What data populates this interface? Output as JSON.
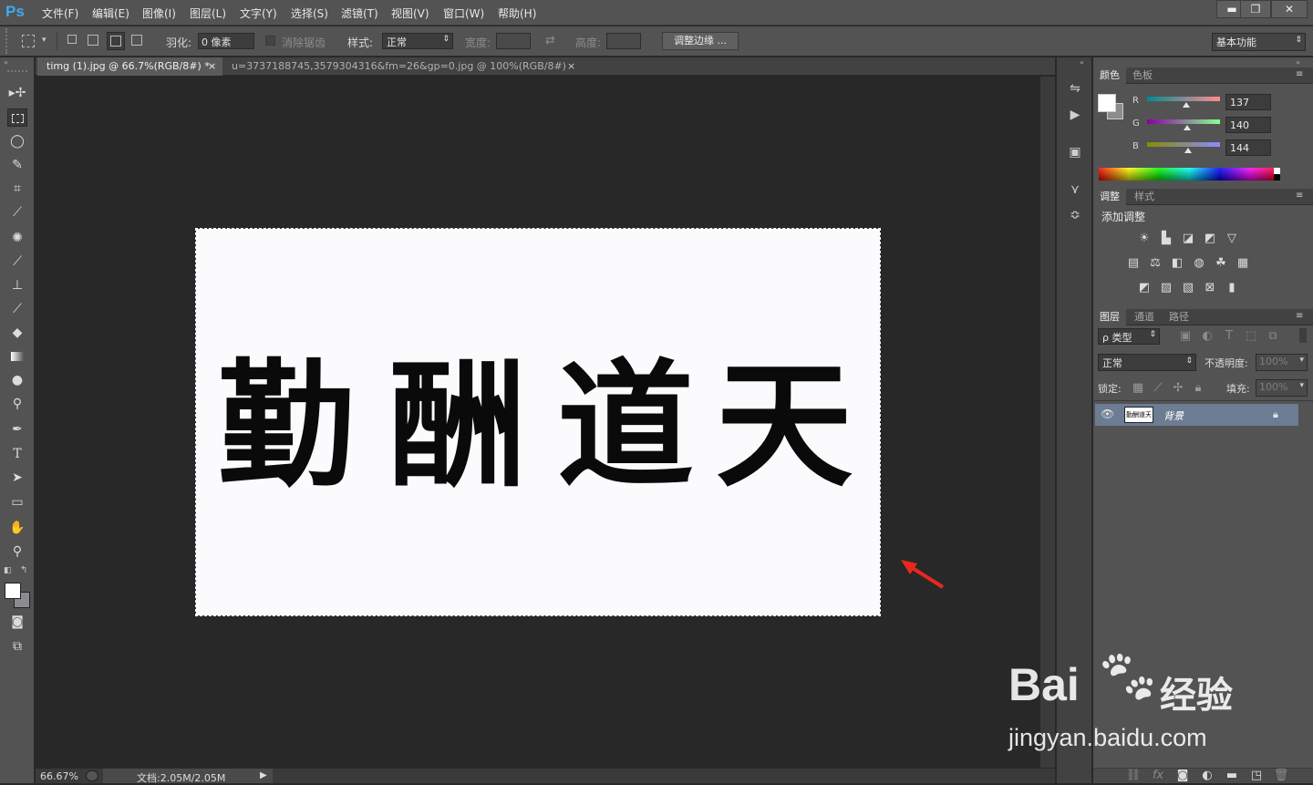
{
  "app": {
    "logo": "Ps",
    "menu": [
      "文件(F)",
      "编辑(E)",
      "图像(I)",
      "图层(L)",
      "文字(Y)",
      "选择(S)",
      "滤镜(T)",
      "视图(V)",
      "窗口(W)",
      "帮助(H)"
    ],
    "window_buttons": {
      "minimize": "▬",
      "restore": "❐",
      "close": "✕"
    }
  },
  "options": {
    "feather_label": "羽化:",
    "feather_value": "0 像素",
    "antialias_label": "消除锯齿",
    "style_label": "样式:",
    "style_value": "正常",
    "width_label": "宽度:",
    "height_label": "高度:",
    "refine_edge": "调整边缘 ...",
    "workspace": "基本功能"
  },
  "tabs": [
    {
      "label": "timg (1).jpg @ 66.7%(RGB/8#) *",
      "close": "×"
    },
    {
      "label": "u=3737188745,3579304316&fm=26&gp=0.jpg @ 100%(RGB/8#)",
      "close": "×"
    }
  ],
  "document": {
    "characters": [
      "勤",
      "酬",
      "道",
      "天"
    ]
  },
  "status": {
    "zoom": "66.67%",
    "doc_size": "文档:2.05M/2.05M"
  },
  "color_panel": {
    "tabs": [
      "颜色",
      "色板"
    ],
    "r_label": "R",
    "r_value": "137",
    "g_label": "G",
    "g_value": "140",
    "b_label": "B",
    "b_value": "144",
    "r": 137,
    "g": 140,
    "b": 144
  },
  "adjust_panel": {
    "tabs": [
      "调整",
      "样式"
    ],
    "title": "添加调整"
  },
  "layers_panel": {
    "tabs": [
      "图层",
      "通道",
      "路径"
    ],
    "filter": "ρ 类型",
    "blend_mode": "正常",
    "opacity_label": "不透明度:",
    "opacity_value": "100%",
    "lock_label": "锁定:",
    "fill_label": "填充:",
    "fill_value": "100%",
    "layer_name": "背景"
  },
  "watermark": {
    "brand": "Bai",
    "brand_cn": "经验",
    "url": "jingyan.baidu.com"
  },
  "colors": {
    "chrome": "#535353",
    "canvas": "#282828",
    "accent": "#3fa9f5",
    "arrow": "#e8281e"
  }
}
